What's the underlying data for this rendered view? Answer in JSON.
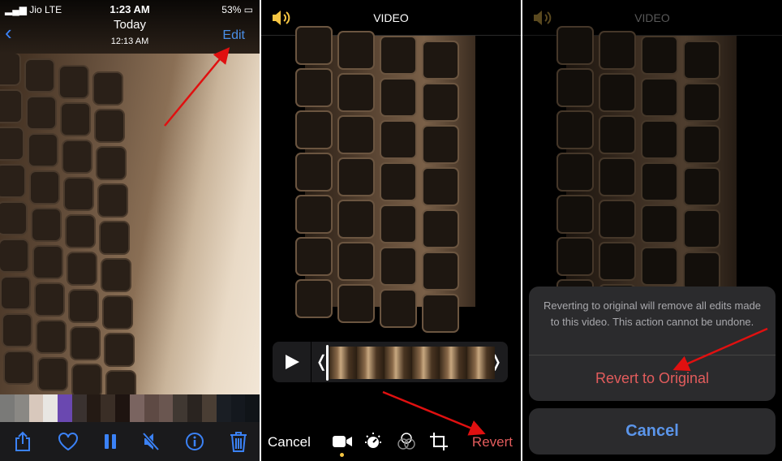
{
  "panel1": {
    "status": {
      "carrier": "Jio",
      "network": "LTE",
      "time": "1:23 AM",
      "battery": "53%"
    },
    "nav": {
      "title": "Today",
      "subtitle": "12:13 AM",
      "edit_label": "Edit",
      "back_icon": "chevron-left-icon"
    },
    "thumbnail_colors": [
      "#7a7a78",
      "#8a8884",
      "#d8c8bc",
      "#e8e6e2",
      "#6a48b0",
      "#3a3230",
      "#241a14",
      "#3a2e26",
      "#1e1410",
      "#7a6460",
      "#5e4a44",
      "#6a5650",
      "#403832",
      "#2a2420",
      "#4a3e34",
      "#1a1e24",
      "#14181e",
      "#101418"
    ],
    "toolbar": [
      "share-icon",
      "heart-icon",
      "pause-icon",
      "mute-icon",
      "info-icon",
      "trash-icon"
    ]
  },
  "panel2": {
    "header_title": "VIDEO",
    "cancel_label": "Cancel",
    "revert_label": "Revert",
    "tools": [
      "video-camera-icon",
      "adjust-dial-icon",
      "filters-icon",
      "crop-rotate-icon"
    ]
  },
  "panel3": {
    "header_title": "VIDEO",
    "dialog_message": "Reverting to original will remove all edits made to this video. This action cannot be undone.",
    "revert_to_original_label": "Revert to Original",
    "cancel_label": "Cancel"
  },
  "colors": {
    "accent_blue": "#3b82f6",
    "destructive_red": "#e25c5c",
    "annotation_arrow": "#e01010",
    "speaker_yellow": "#f5c542"
  }
}
